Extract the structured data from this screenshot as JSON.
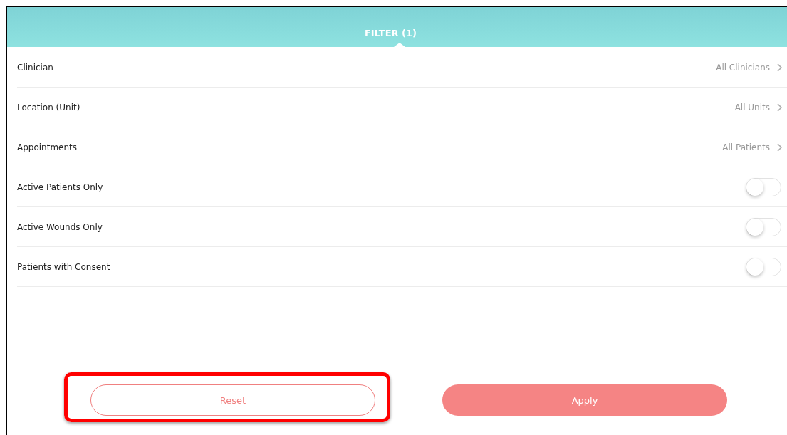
{
  "header": {
    "title": "FILTER (1)"
  },
  "rows": [
    {
      "kind": "link",
      "label": "Clinician",
      "value": "All Clinicians",
      "divider": false
    },
    {
      "kind": "link",
      "label": "Location (Unit)",
      "value": "All Units",
      "divider": true
    },
    {
      "kind": "link",
      "label": "Appointments",
      "value": "All Patients",
      "divider": true
    },
    {
      "kind": "toggle",
      "label": "Active Patients Only",
      "on": false,
      "divider": true
    },
    {
      "kind": "toggle",
      "label": "Active Wounds Only",
      "on": false,
      "divider": true
    },
    {
      "kind": "toggle",
      "label": "Patients with Consent",
      "on": false,
      "divider": true
    },
    {
      "kind": "empty",
      "divider": true
    }
  ],
  "buttons": [
    {
      "kind": "outline",
      "label": "Reset",
      "highlighted": true
    },
    {
      "kind": "filled",
      "label": "Apply",
      "highlighted": false
    }
  ]
}
